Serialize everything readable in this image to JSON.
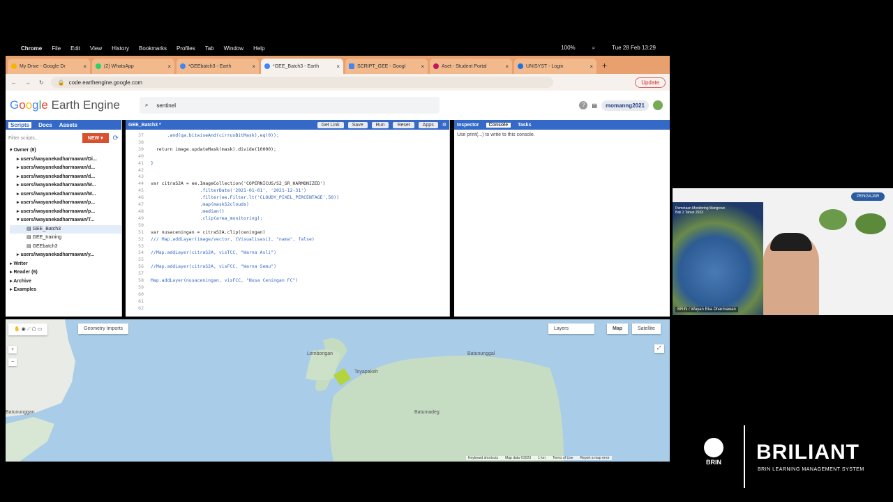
{
  "menubar": {
    "apple": "",
    "app": "Chrome",
    "items": [
      "File",
      "Edit",
      "View",
      "History",
      "Bookmarks",
      "Profiles",
      "Tab",
      "Window",
      "Help"
    ],
    "battery": "100%",
    "clock": "Tue 28 Feb 13:29"
  },
  "tabs": [
    {
      "label": "My Drive - Google Dr",
      "color": "#f4b400"
    },
    {
      "label": "(2) WhatsApp",
      "color": "#25d366"
    },
    {
      "label": "*GEEbatch3 - Earth",
      "color": "#4285f4"
    },
    {
      "label": "*GEE_Batch3 - Earth",
      "color": "#4285f4",
      "active": true
    },
    {
      "label": "SCRIPT_GEE - Googl",
      "color": "#4285f4"
    },
    {
      "label": "Aset - Student Portal",
      "color": "#c2185b"
    },
    {
      "label": "UNISYST - Login",
      "color": "#1a73e8"
    }
  ],
  "address": {
    "url": "code.earthengine.google.com",
    "update": "Update"
  },
  "header": {
    "logo_google": "Google",
    "logo_rest": "Earth Engine",
    "search": "sentinel",
    "username": "momanng2021"
  },
  "left": {
    "tabs": [
      "Scripts",
      "Docs",
      "Assets"
    ],
    "filter_placeholder": "Filter scripts...",
    "new": "NEW",
    "tree": [
      "Owner (8)",
      "users/iwayanekadharmawan/Di...",
      "users/iwayanekadharmawan/d...",
      "users/iwayanekadharmawan/d...",
      "users/iwayanekadharmawan/M...",
      "users/iwayanekadharmawan/M...",
      "users/iwayanekadharmawan/p...",
      "users/iwayanekadharmawan/p...",
      "users/iwayanekadharmawan/T...",
      "GEE_Batch3",
      "GEE_training",
      "GEEbatch3",
      "users/iwayanekadharmawan/y...",
      "Writer",
      "Reader (6)",
      "Archive",
      "Examples"
    ]
  },
  "editor": {
    "title": "GEE_Batch3 *",
    "buttons": [
      "Get Link",
      "Save",
      "Run",
      "Reset",
      "Apps"
    ],
    "lines": [
      {
        "n": "37",
        "t": "      .and(qa.bitwiseAnd(cirrusBitMask).eq(0));"
      },
      {
        "n": "38",
        "t": ""
      },
      {
        "n": "39",
        "t": "  return image.updateMask(mask).divide(10000);"
      },
      {
        "n": "40",
        "t": ""
      },
      {
        "n": "41",
        "t": "}"
      },
      {
        "n": "42",
        "t": ""
      },
      {
        "n": "43",
        "t": ""
      },
      {
        "n": "44",
        "t": "var citraS2A = ee.ImageCollection('COPERNICUS/S2_SR_HARMONIZED')"
      },
      {
        "n": "45",
        "t": "                  .filterDate('2021-01-01', '2021-12-31')"
      },
      {
        "n": "46",
        "t": "                  .filter(ee.Filter.lt('CLOUDY_PIXEL_PERCENTAGE',50))"
      },
      {
        "n": "47",
        "t": "                  .map(maskS2clouds)"
      },
      {
        "n": "48",
        "t": "                  .median()"
      },
      {
        "n": "49",
        "t": "                  .clip(area_monitoring);"
      },
      {
        "n": "50",
        "t": ""
      },
      {
        "n": "51",
        "t": "var nusaceningan = citraS2A.clip(ceningan)"
      },
      {
        "n": "52",
        "t": "/// Map.addLayer(image/vector, {Visualisasi}, \"nama\", false)"
      },
      {
        "n": "53",
        "t": ""
      },
      {
        "n": "54",
        "t": "//Map.addLayer(citraS2A, visTCC, \"Warna Asli\")"
      },
      {
        "n": "55",
        "t": ""
      },
      {
        "n": "56",
        "t": "//Map.addLayer(citraS2A, visFCC, \"Warna Semu\")"
      },
      {
        "n": "57",
        "t": ""
      },
      {
        "n": "58",
        "t": "Map.addLayer(nusaceningan, visFCC, \"Nusa Ceningan FC\")"
      },
      {
        "n": "59",
        "t": ""
      },
      {
        "n": "60",
        "t": ""
      },
      {
        "n": "61",
        "t": ""
      },
      {
        "n": "62",
        "t": ""
      }
    ]
  },
  "right": {
    "tabs": [
      "Inspector",
      "Console",
      "Tasks"
    ],
    "message": "Use print(...) to write to this console."
  },
  "map": {
    "geometry": "Geometry Imports",
    "layers": "Layers",
    "map": "Map",
    "satellite": "Satellite",
    "labels": [
      "Lembongan",
      "Toyapakeh",
      "Batununggal",
      "Batumadeg",
      "Batununggan"
    ],
    "footer": [
      "Keyboard shortcuts",
      "Map data ©2023",
      "1 km",
      "Terms of Use",
      "Report a map error"
    ]
  },
  "cam": {
    "name": "BRIN / Wayan Eka Dharmawan",
    "badge": "PENGAJAR",
    "slide_title": "Pemetaan Monitoring Mangrove Bali 2 Tahun 2023"
  },
  "brand": {
    "org": "BRIN",
    "name": "BRILIANT",
    "tagline": "BRIN LEARNING MANAGEMENT SYSTEM"
  }
}
